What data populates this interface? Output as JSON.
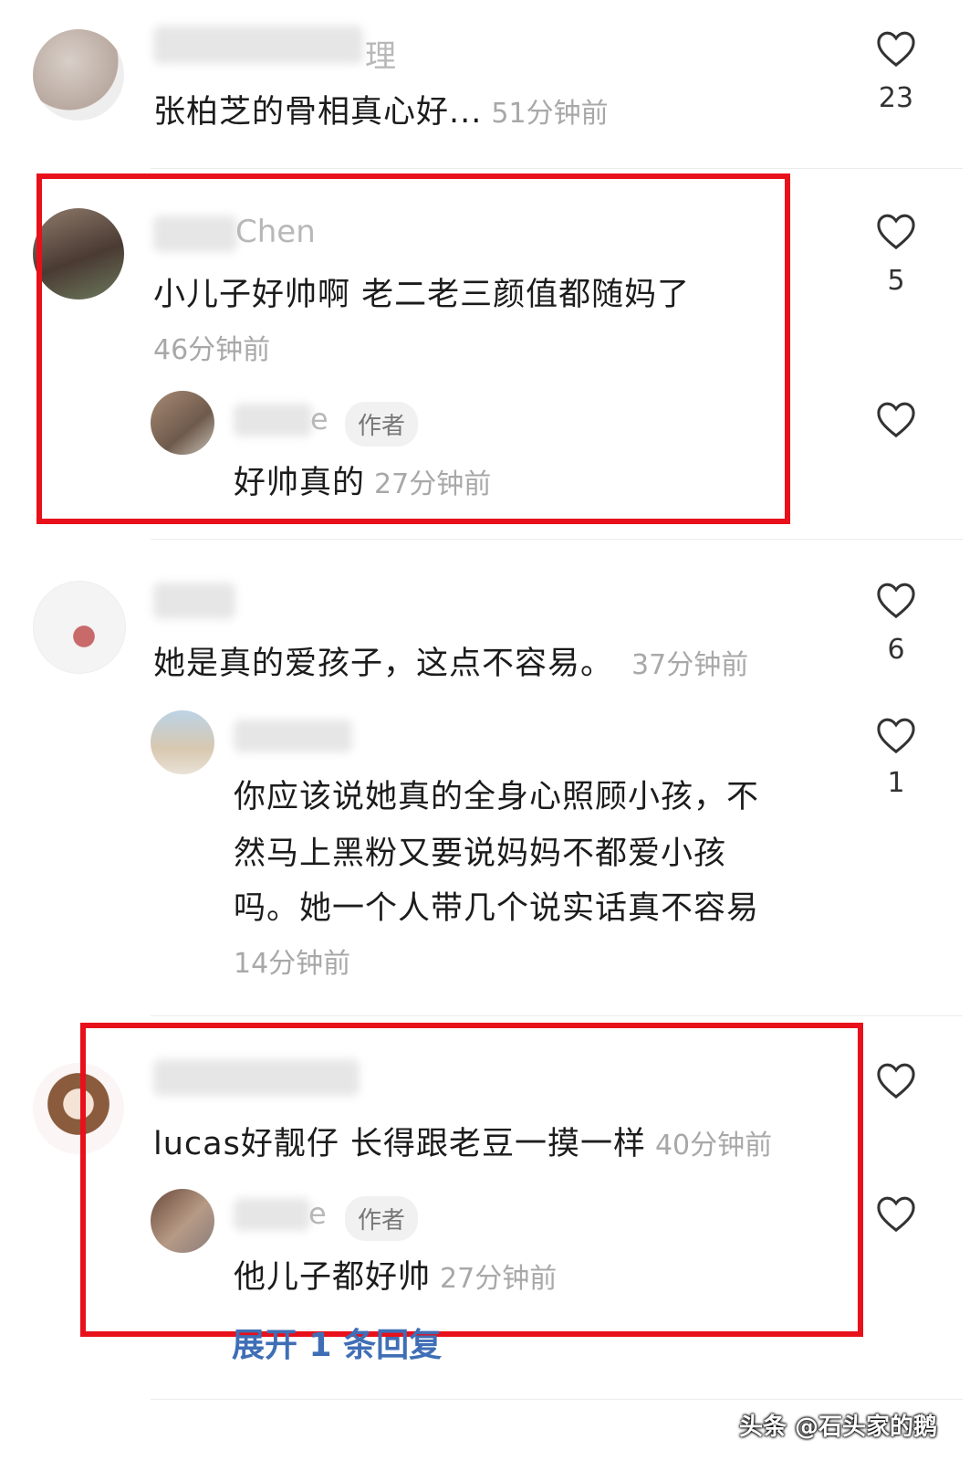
{
  "comments": [
    {
      "name": "理",
      "text": "张柏芝的骨相真心好...",
      "time": "51分钟前",
      "likes": "23"
    },
    {
      "name": "Chen",
      "text": "小儿子好帅啊 老二老三颜值都随妈了",
      "time": "46分钟前",
      "likes": "5",
      "reply": {
        "name": "e",
        "badge": "作者",
        "text": "好帅真的",
        "time": "27分钟前"
      }
    },
    {
      "text": "她是真的爱孩子，这点不容易。",
      "time": "37分钟前",
      "likes": "6",
      "reply": {
        "line1": "你应该说她真的全身心照顾小孩，不",
        "line2": "然马上黑粉又要说妈妈不都爱小孩",
        "line3": "吗。她一个人带几个说实话真不容易",
        "time": "14分钟前",
        "likes": "1"
      }
    },
    {
      "text": "lucas好靓仔 长得跟老豆一摸一样",
      "time": "40分钟前",
      "reply": {
        "name": "e",
        "badge": "作者",
        "text": "他儿子都好帅",
        "time": "27分钟前"
      },
      "expand": "展开 1 条回复"
    }
  ],
  "watermark": "头条 @石头家的鹅",
  "colors": {
    "highlight": "#e8101a",
    "link": "#3f6eb6",
    "muted": "#a8a8a8"
  }
}
